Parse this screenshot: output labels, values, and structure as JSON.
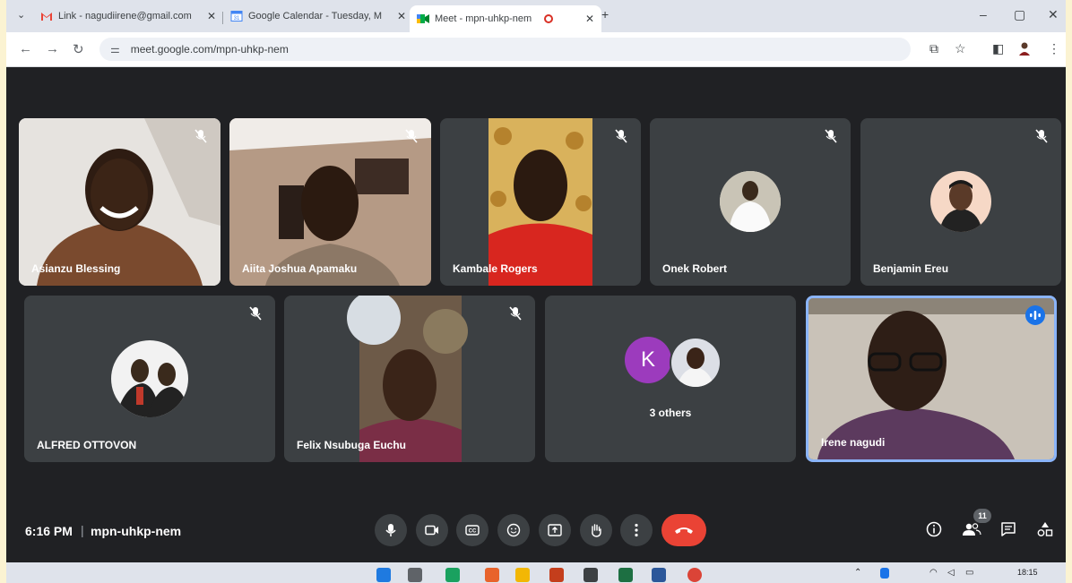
{
  "browser": {
    "tabs": [
      {
        "label": "Link - nagudiirene@gmail.com",
        "icon": "gmail-icon"
      },
      {
        "label": "Google Calendar - Tuesday, M",
        "icon": "calendar-icon"
      },
      {
        "label": "Meet - mpn-uhkp-nem",
        "icon": "meet-icon",
        "active": true
      }
    ],
    "new_tab": "+",
    "url": "meet.google.com/mpn-uhkp-nem",
    "window_controls": [
      "–",
      "▢",
      "✕"
    ]
  },
  "participants": [
    {
      "name": "Asianzu Blessing",
      "muted": true,
      "view": "video"
    },
    {
      "name": "Aiita Joshua Apamaku",
      "muted": true,
      "view": "video"
    },
    {
      "name": "Kambale Rogers",
      "muted": true,
      "view": "video"
    },
    {
      "name": "Onek Robert",
      "muted": true,
      "view": "avatar"
    },
    {
      "name": "Benjamin Ereu",
      "muted": true,
      "view": "avatar"
    },
    {
      "name": "ALFRED OTTOVON",
      "muted": true,
      "view": "avatar"
    },
    {
      "name": "Felix Nsubuga Euchu",
      "muted": true,
      "view": "video"
    },
    {
      "name": "Irene nagudi",
      "muted": false,
      "speaking": true,
      "view": "video"
    }
  ],
  "others_tile": {
    "initial": "K",
    "label": "3 others",
    "initial_color": "#9c3bbd"
  },
  "meeting": {
    "time": "6:16 PM",
    "code": "mpn-uhkp-nem",
    "people_count": "11"
  },
  "controls": [
    "mic-icon",
    "camera-icon",
    "captions-icon",
    "emoji-icon",
    "present-icon",
    "raise-hand-icon",
    "more-options-icon",
    "leave-call-icon"
  ],
  "side_controls": [
    "info-icon",
    "people-icon",
    "chat-icon",
    "activities-icon"
  ],
  "taskbar": {
    "clock": "18:15"
  },
  "colors": {
    "stage": "#202124",
    "tile": "#3c4043",
    "end_call": "#ea4335",
    "speaking_border": "#8ab4f8"
  }
}
